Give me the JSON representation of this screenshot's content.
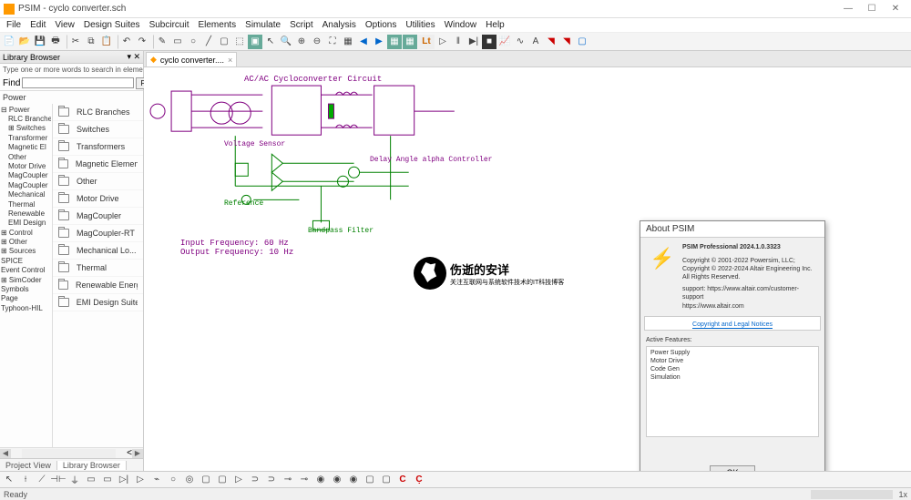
{
  "window": {
    "title": "PSIM - cyclo converter.sch"
  },
  "menu": [
    "File",
    "Edit",
    "View",
    "Design Suites",
    "Subcircuit",
    "Elements",
    "Simulate",
    "Script",
    "Analysis",
    "Options",
    "Utilities",
    "Window",
    "Help"
  ],
  "library_browser": {
    "title": "Library Browser",
    "hint": "Type one or more words to search in element's name and descrip",
    "find_label": "Find",
    "find_btn": "Find",
    "section": "Power",
    "tree": [
      {
        "t": "Power",
        "ind": 0,
        "exp": "⊟"
      },
      {
        "t": "RLC Branche",
        "ind": 1,
        "exp": ""
      },
      {
        "t": "Switches",
        "ind": 1,
        "exp": "⊞"
      },
      {
        "t": "Transformer",
        "ind": 1,
        "exp": ""
      },
      {
        "t": "Magnetic El",
        "ind": 1,
        "exp": ""
      },
      {
        "t": "Other",
        "ind": 1,
        "exp": ""
      },
      {
        "t": "Motor Drive",
        "ind": 1,
        "exp": ""
      },
      {
        "t": "MagCoupler",
        "ind": 1,
        "exp": ""
      },
      {
        "t": "MagCoupler",
        "ind": 1,
        "exp": ""
      },
      {
        "t": "Mechanical",
        "ind": 1,
        "exp": ""
      },
      {
        "t": "Thermal",
        "ind": 1,
        "exp": ""
      },
      {
        "t": "Renewable",
        "ind": 1,
        "exp": ""
      },
      {
        "t": "EMI Design",
        "ind": 1,
        "exp": ""
      },
      {
        "t": "Control",
        "ind": 0,
        "exp": "⊞"
      },
      {
        "t": "Other",
        "ind": 0,
        "exp": "⊞"
      },
      {
        "t": "Sources",
        "ind": 0,
        "exp": "⊞"
      },
      {
        "t": "SPICE",
        "ind": 0,
        "exp": ""
      },
      {
        "t": "Event Control",
        "ind": 0,
        "exp": ""
      },
      {
        "t": "SimCoder",
        "ind": 0,
        "exp": "⊞"
      },
      {
        "t": "Symbols",
        "ind": 0,
        "exp": ""
      },
      {
        "t": "Page",
        "ind": 0,
        "exp": ""
      },
      {
        "t": "Typhoon-HIL",
        "ind": 0,
        "exp": ""
      }
    ],
    "categories": [
      "RLC Branches",
      "Switches",
      "Transformers",
      "Magnetic Elements",
      "Other",
      "Motor Drive",
      "MagCoupler",
      "MagCoupler-RT",
      "Mechanical Lo...",
      "Thermal",
      "Renewable Energy",
      "EMI Design Suite"
    ]
  },
  "tab": {
    "name": "cyclo converter...."
  },
  "schematic": {
    "title": "AC/AC Cycloconverter Circuit",
    "voltage_sensor": "Voltage Sensor",
    "reference": "Reference",
    "bandpass": "Bandpass Filter",
    "delay": "Delay Angle alpha Controller",
    "input_freq": "Input Frequency: 60 Hz",
    "output_freq": "Output Frequency: 10 Hz"
  },
  "about": {
    "title": "About PSIM",
    "product": "PSIM Professional 2024.1.0.3323",
    "copyright1": "Copyright © 2001-2022 Powersim, LLC;",
    "copyright2": "Copyright © 2022-2024 Altair Engineering Inc.",
    "rights": "All Rights Reserved.",
    "support": "support: https://www.altair.com/customer-support",
    "url": "https://www.altair.com",
    "legal": "Copyright and Legal Notices",
    "features_label": "Active Features:",
    "features": [
      "Power Supply",
      "Motor Drive",
      "Code Gen",
      "Simulation"
    ],
    "ok": "OK"
  },
  "bottom_tabs": [
    "Project View",
    "Library Browser"
  ],
  "status": {
    "ready": "Ready",
    "zoom": "1x"
  },
  "watermark": {
    "line1": "伤逝的安详",
    "line2": "关注互联网与系统软件技术的IT科技博客"
  }
}
